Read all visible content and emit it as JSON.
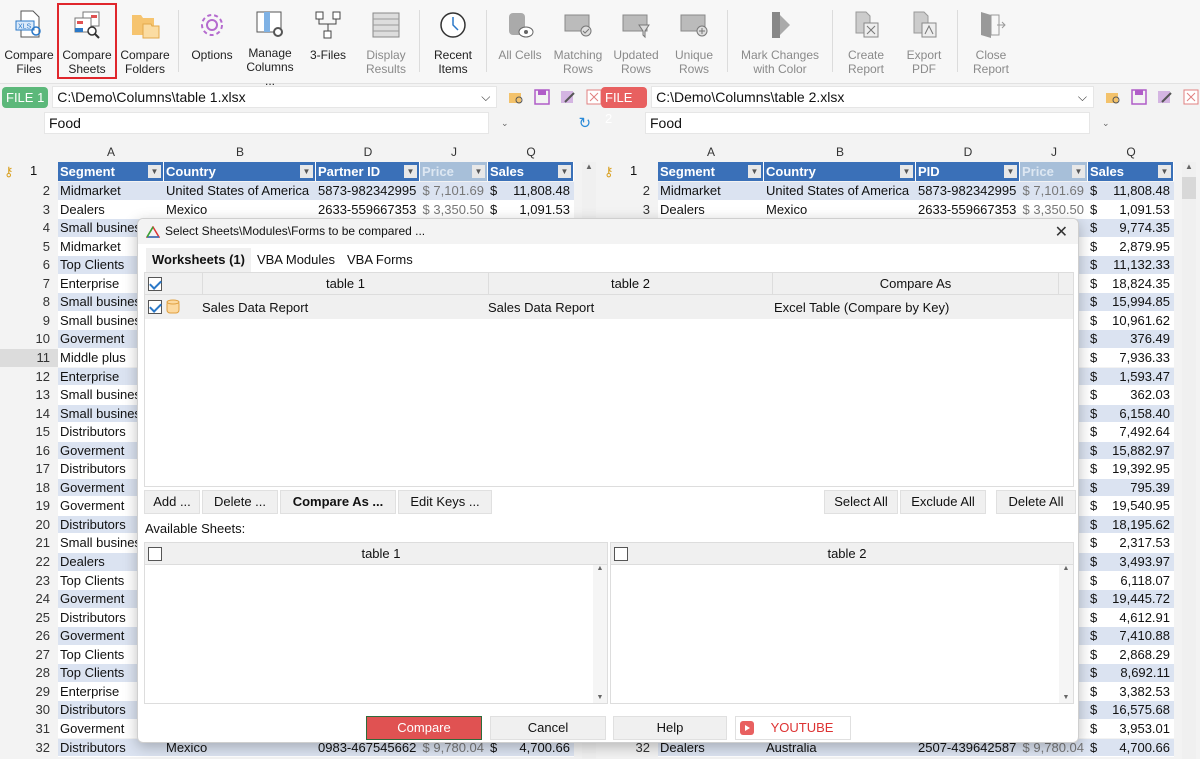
{
  "ribbon": {
    "buttons": [
      {
        "id": "compare-files",
        "label": "Compare\nFiles",
        "icon": "xls-compare-icon",
        "disabled": false
      },
      {
        "id": "compare-sheets",
        "label": "Compare\nSheets",
        "icon": "sheets-compare-icon",
        "disabled": false,
        "selected": true
      },
      {
        "id": "compare-folders",
        "label": "Compare\nFolders",
        "icon": "folders-icon",
        "disabled": false
      },
      {
        "id": "options",
        "label": "Options",
        "icon": "gear-icon",
        "disabled": false
      },
      {
        "id": "manage-columns",
        "label": "Manage\nColumns ...",
        "icon": "columns-gear-icon",
        "disabled": false
      },
      {
        "id": "3-files",
        "label": "3-Files",
        "icon": "three-files-icon",
        "disabled": false
      },
      {
        "id": "display-results",
        "label": "Display\nResults",
        "icon": "table-icon",
        "disabled": true
      },
      {
        "id": "recent-items",
        "label": "Recent\nItems",
        "icon": "history-clock-icon",
        "disabled": false
      },
      {
        "id": "all-cells",
        "label": "All Cells",
        "icon": "database-eye-icon",
        "disabled": true
      },
      {
        "id": "matching-rows",
        "label": "Matching\nRows",
        "icon": "rows-check-icon",
        "disabled": true
      },
      {
        "id": "updated-rows",
        "label": "Updated\nRows",
        "icon": "rows-filter-icon",
        "disabled": true
      },
      {
        "id": "unique-rows",
        "label": "Unique\nRows",
        "icon": "rows-plus-icon",
        "disabled": true
      },
      {
        "id": "mark-changes",
        "label": "Mark Changes\nwith Color",
        "icon": "color-swatch-icon",
        "disabled": true
      },
      {
        "id": "create-report",
        "label": "Create\nReport",
        "icon": "excel-report-icon",
        "disabled": true
      },
      {
        "id": "export-pdf",
        "label": "Export\nPDF",
        "icon": "pdf-export-icon",
        "disabled": true
      },
      {
        "id": "close-report",
        "label": "Close\nReport",
        "icon": "close-report-icon",
        "disabled": true
      }
    ]
  },
  "file1": {
    "badge": "FILE 1",
    "path": "C:\\Demo\\Columns\\table 1.xlsx",
    "sheet": "Food",
    "color": "#5cb87a"
  },
  "file2": {
    "badge": "FILE 2",
    "path": "C:\\Demo\\Columns\\table 2.xlsx",
    "sheet": "Food",
    "color": "#e86060"
  },
  "left_grid": {
    "col_letters": [
      "A",
      "B",
      "D",
      "J",
      "Q"
    ],
    "headers": [
      "Segment",
      "Country",
      "Partner ID",
      "Price",
      "Sales"
    ],
    "rows": [
      {
        "n": "2",
        "seg": "Midmarket",
        "country": "United States of America",
        "id": "5873-982342995",
        "price": "$ 7,101.69",
        "sales": "11,808.48"
      },
      {
        "n": "3",
        "seg": "Dealers",
        "country": "Mexico",
        "id": "2633-559667353",
        "price": "$ 3,350.50",
        "sales": "1,091.53"
      },
      {
        "n": "4",
        "seg": "Small business"
      },
      {
        "n": "5",
        "seg": "Midmarket"
      },
      {
        "n": "6",
        "seg": "Top Clients"
      },
      {
        "n": "7",
        "seg": "Enterprise"
      },
      {
        "n": "8",
        "seg": "Small business"
      },
      {
        "n": "9",
        "seg": "Small business"
      },
      {
        "n": "10",
        "seg": "Goverment"
      },
      {
        "n": "11",
        "seg": "Middle plus"
      },
      {
        "n": "12",
        "seg": "Enterprise"
      },
      {
        "n": "13",
        "seg": "Small business"
      },
      {
        "n": "14",
        "seg": "Small business"
      },
      {
        "n": "15",
        "seg": "Distributors"
      },
      {
        "n": "16",
        "seg": "Goverment"
      },
      {
        "n": "17",
        "seg": "Distributors"
      },
      {
        "n": "18",
        "seg": "Goverment"
      },
      {
        "n": "19",
        "seg": "Goverment"
      },
      {
        "n": "20",
        "seg": "Distributors"
      },
      {
        "n": "21",
        "seg": "Small business"
      },
      {
        "n": "22",
        "seg": "Dealers"
      },
      {
        "n": "23",
        "seg": "Top Clients"
      },
      {
        "n": "24",
        "seg": "Goverment"
      },
      {
        "n": "25",
        "seg": "Distributors"
      },
      {
        "n": "26",
        "seg": "Goverment"
      },
      {
        "n": "27",
        "seg": "Top Clients"
      },
      {
        "n": "28",
        "seg": "Top Clients"
      },
      {
        "n": "29",
        "seg": "Enterprise"
      },
      {
        "n": "30",
        "seg": "Distributors"
      },
      {
        "n": "31",
        "seg": "Goverment"
      },
      {
        "n": "32",
        "seg": "Distributors",
        "country": "Mexico",
        "id": "0983-467545662",
        "price": "$ 9,780.04",
        "sales": "4,700.66"
      }
    ]
  },
  "right_grid": {
    "col_letters": [
      "A",
      "B",
      "D",
      "J",
      "Q"
    ],
    "headers": [
      "Segment",
      "Country",
      "PID",
      "Price",
      "Sales"
    ],
    "rows": [
      {
        "n": "2",
        "seg": "Midmarket",
        "country": "United States of America",
        "id": "5873-982342995",
        "price": "$ 7,101.69"
      },
      {
        "n": "3",
        "seg": "Dealers",
        "country": "Mexico",
        "id": "2633-559667353",
        "price": "$ 3,350.50"
      },
      {
        "n": "32",
        "seg": "Dealers",
        "country": "Australia",
        "id": "2507-439642587",
        "price": "$ 9,780.04"
      }
    ],
    "sales": [
      "11,808.48",
      "1,091.53",
      "9,774.35",
      "2,879.95",
      "11,132.33",
      "18,824.35",
      "15,994.85",
      "10,961.62",
      "376.49",
      "7,936.33",
      "1,593.47",
      "362.03",
      "6,158.40",
      "7,492.64",
      "15,882.97",
      "19,392.95",
      "795.39",
      "19,540.95",
      "18,195.62",
      "2,317.53",
      "3,493.97",
      "6,118.07",
      "19,445.72",
      "4,612.91",
      "7,410.88",
      "2,868.29",
      "8,692.11",
      "3,382.53",
      "16,575.68",
      "3,953.01",
      "4,700.66"
    ]
  },
  "dialog": {
    "title": "Select Sheets\\Modules\\Forms to be compared ...",
    "tabs": [
      "Worksheets (1)",
      "VBA Modules",
      "VBA Forms"
    ],
    "table_headers": [
      "table 1",
      "table 2",
      "Compare As"
    ],
    "pairs": [
      {
        "t1": "Sales Data Report",
        "t2": "Sales Data Report",
        "as": "Excel Table (Compare by Key)"
      }
    ],
    "left_buttons": [
      "Add ...",
      "Delete ...",
      "Compare As ...",
      "Edit Keys ..."
    ],
    "right_buttons": [
      "Select All",
      "Exclude All",
      "Delete All"
    ],
    "available_label": "Available Sheets:",
    "avail_headers": [
      "table 1",
      "table 2"
    ],
    "footer": {
      "compare": "Compare",
      "cancel": "Cancel",
      "help": "Help",
      "youtube": "YOUTUBE"
    }
  }
}
